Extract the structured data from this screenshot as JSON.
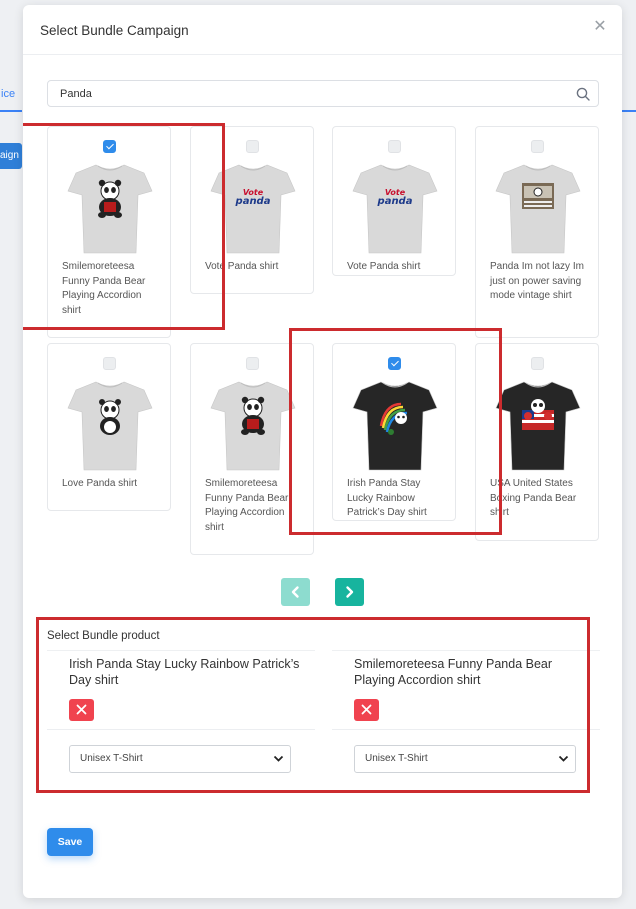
{
  "background": {
    "tab_fragment": "ice",
    "button_fragment": "aign"
  },
  "modal": {
    "title": "Select Bundle Campaign",
    "close_icon": "close-icon"
  },
  "search": {
    "value": "Panda",
    "placeholder": ""
  },
  "products": [
    {
      "name": "Smilemoreteesa Funny Panda Bear Playing Accordion shirt",
      "checked": true,
      "shirt_color": "#d9d9d9",
      "design": "panda-accordion"
    },
    {
      "name": "Vote Panda shirt",
      "checked": false,
      "shirt_color": "#d9d9d9",
      "design": "vote-panda"
    },
    {
      "name": "Vote Panda shirt",
      "checked": false,
      "shirt_color": "#d9d9d9",
      "design": "vote-panda"
    },
    {
      "name": "Panda Im not lazy Im just on power saving mode vintage shirt",
      "checked": false,
      "shirt_color": "#d9d9d9",
      "design": "vintage-panda"
    },
    {
      "name": "Love Panda shirt",
      "checked": false,
      "shirt_color": "#d9d9d9",
      "design": "love-panda"
    },
    {
      "name": "Smilemoreteesa Funny Panda Bear Playing Accordion shirt",
      "checked": false,
      "shirt_color": "#d9d9d9",
      "design": "panda-accordion"
    },
    {
      "name": "Irish Panda Stay Lucky Rainbow Patrick’s Day shirt",
      "checked": true,
      "shirt_color": "#262626",
      "design": "rainbow-panda"
    },
    {
      "name": "USA United States Boxing Panda Bear shirt",
      "checked": false,
      "shirt_color": "#262626",
      "design": "boxing-panda"
    }
  ],
  "bundle": {
    "label": "Select Bundle product",
    "items": [
      {
        "title": "Irish Panda Stay Lucky Rainbow Patrick’s Day shirt",
        "variant": "Unisex T-Shirt"
      },
      {
        "title": "Smilemoreteesa Funny Panda Bear Playing Accordion shirt",
        "variant": "Unisex T-Shirt"
      }
    ]
  },
  "save_label": "Save",
  "colors": {
    "primary": "#2f8ceb",
    "teal": "#17b49e",
    "teal_light": "#8ddccf",
    "danger": "#f0434f",
    "highlight": "#cc2b2e"
  }
}
